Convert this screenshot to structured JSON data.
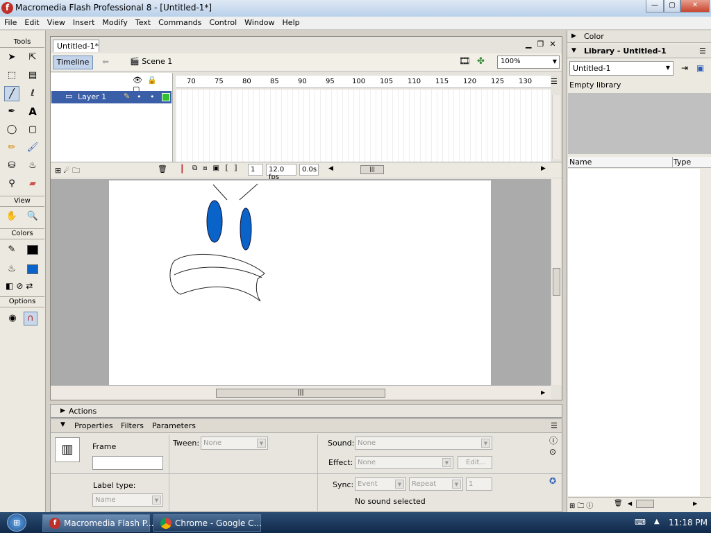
{
  "window": {
    "title": "Macromedia Flash Professional 8 - [Untitled-1*]",
    "min": "—",
    "max": "▢",
    "close": "✕",
    "logo": "f"
  },
  "menu": [
    "File",
    "Edit",
    "View",
    "Insert",
    "Modify",
    "Text",
    "Commands",
    "Control",
    "Window",
    "Help"
  ],
  "tools": {
    "header": "Tools",
    "view_header": "View",
    "colors_header": "Colors",
    "options_header": "Options",
    "stroke_color": "#000000",
    "fill_color": "#0a63c8"
  },
  "document": {
    "tab": "Untitled-1*",
    "timeline_button": "Timeline",
    "scene": "Scene 1",
    "zoom": "100%",
    "layer_name": "Layer 1",
    "ruler": [
      "70",
      "75",
      "80",
      "85",
      "90",
      "95",
      "100",
      "105",
      "110",
      "115",
      "120",
      "125",
      "130"
    ],
    "current_frame": "1",
    "fps": "12.0 fps",
    "elapsed": "0.0s"
  },
  "panels": {
    "actions": "Actions",
    "tabs": [
      "Properties",
      "Filters",
      "Parameters"
    ],
    "frame_label": "Frame",
    "tween_label": "Tween:",
    "tween_value": "None",
    "sound_label": "Sound:",
    "sound_value": "None",
    "effect_label": "Effect:",
    "effect_value": "None",
    "edit_button": "Edit...",
    "label_type_label": "Label type:",
    "label_type_value": "Name",
    "sync_label": "Sync:",
    "sync_value": "Event",
    "repeat_value": "Repeat",
    "repeat_count": "1",
    "no_sound": "No sound selected"
  },
  "right_panel": {
    "color_header": "Color",
    "library_header": "Library - Untitled-1",
    "library_select": "Untitled-1",
    "empty": "Empty library",
    "col_name": "Name",
    "col_type": "Type"
  },
  "taskbar": {
    "items": [
      "Macromedia Flash P...",
      "Chrome - Google C..."
    ],
    "time": "11:18 PM"
  }
}
